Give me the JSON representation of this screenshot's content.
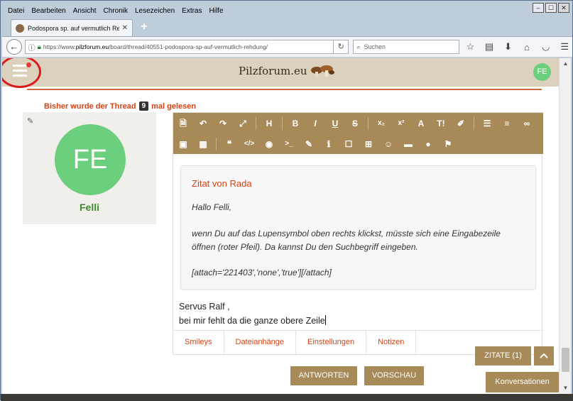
{
  "menubar": [
    "Datei",
    "Bearbeiten",
    "Ansicht",
    "Chronik",
    "Lesezeichen",
    "Extras",
    "Hilfe"
  ],
  "tab": {
    "title": "Podospora sp. auf vermutlich Re",
    "close": "✕",
    "new_tab": "+"
  },
  "nav": {
    "url_prefix": "https://www.",
    "url_domain": "pilzforum.eu",
    "url_path": "/board/thread/40551-podospora-sp-auf-vermutlich-rehdung/",
    "search_placeholder": "Suchen"
  },
  "site": {
    "logo": "Pilzforum.eu",
    "user_initials": "FE"
  },
  "thread": {
    "read_prefix": "Bisher wurde der Thread",
    "read_count": "9",
    "read_suffix": "mal gelesen"
  },
  "user": {
    "initials": "FE",
    "name": "Felli"
  },
  "quote": {
    "title": "Zitat von Rada",
    "line1": "Hallo Felli,",
    "line2": "wenn Du auf das Lupensymbol oben rechts klickst, müsste sich eine Eingabezeile",
    "line3": "öffnen (roter Pfeil). Da kannst Du den Suchbegriff eingeben.",
    "line4": "[attach='221403','none','true'][/attach]"
  },
  "message": {
    "line1": "Servus Ralf ,",
    "line2": "bei mir fehlt da die ganze obere Zeile"
  },
  "editor_tabs": [
    "Smileys",
    "Dateianhänge",
    "Einstellungen",
    "Notizen"
  ],
  "buttons": {
    "reply": "ANTWORTEN",
    "preview": "VORSCHAU",
    "quotes": "ZITATE (1)",
    "conversations": "Konversationen"
  },
  "colors": {
    "accent": "#a88958",
    "link": "#d84315",
    "avatar": "#6ccf7e",
    "header": "#dcd1bd"
  }
}
